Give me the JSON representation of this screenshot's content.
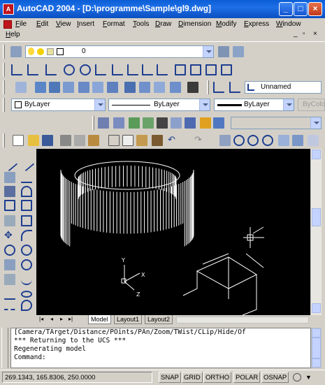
{
  "window": {
    "title": "AutoCAD 2004 - [D:\\programme\\Sample\\gl9.dwg]",
    "min_symbol": "_",
    "max_symbol": "□",
    "close_symbol": "×"
  },
  "menu": {
    "items": [
      "File",
      "Edit",
      "View",
      "Insert",
      "Format",
      "Tools",
      "Draw",
      "Dimension",
      "Modify",
      "Express",
      "Window"
    ],
    "help": "Help",
    "doc_controls": [
      "_",
      "▫",
      "×"
    ]
  },
  "layers": {
    "current_layer": "0"
  },
  "ucs": {
    "named_view": "Unnamed"
  },
  "properties": {
    "color": "ByLayer",
    "linetype": "ByLayer",
    "lineweight": "ByLayer",
    "plotstyle": "ByColor"
  },
  "layout_tabs": [
    "Model",
    "Layout1",
    "Layout2"
  ],
  "command": {
    "lines": [
      "[Camera/TArget/Distance/POints/PAn/Zoom/TWist/CLip/Hide/Of",
      "*** Returning to the UCS ***",
      "Regenerating model",
      "Command:"
    ]
  },
  "status": {
    "coordinates": "269.1343, 165.8306, 250.0000",
    "toggles": [
      "SNAP",
      "GRID",
      "ORTHO",
      "POLAR",
      "OSNAP"
    ]
  },
  "ucs_icon": {
    "x": "X",
    "y": "Y",
    "z": "Z"
  },
  "colors": {
    "titlebar": "#0a5ed6",
    "drawing_bg": "#000000",
    "geometry": "#ffffff"
  }
}
